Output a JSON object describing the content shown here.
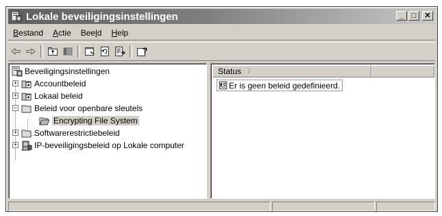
{
  "window": {
    "title": "Lokale beveiligingsinstellingen",
    "caption_buttons": [
      "_",
      "□",
      "✕"
    ]
  },
  "menu": [
    {
      "label": "Bestand",
      "accel_index": 0
    },
    {
      "label": "Actie",
      "accel_index": 0
    },
    {
      "label": "Beeld",
      "accel_index": 3
    },
    {
      "label": "Help",
      "accel_index": 0
    }
  ],
  "toolbar": {
    "buttons": [
      "back-icon",
      "forward-icon",
      "up-one-level-icon",
      "show-hide-tree-icon",
      "properties-icon",
      "refresh-icon",
      "export-list-icon",
      "help-icon"
    ]
  },
  "tree": {
    "root": "Beveiligingsinstellingen",
    "items": [
      {
        "label": "Accountbeleid",
        "expander": "+",
        "icon": "policy-folder-icon"
      },
      {
        "label": "Lokaal beleid",
        "expander": "+",
        "icon": "policy-folder-icon"
      },
      {
        "label": "Beleid voor openbare sleutels",
        "expander": "−",
        "icon": "folder-open-icon"
      },
      {
        "label": "Encrypting File System",
        "icon": "folder-icon",
        "selected": true
      },
      {
        "label": "Softwarerestrictiebeleid",
        "expander": "+",
        "icon": "folder-icon"
      },
      {
        "label": "IP-beveiligingsbeleid op Lokale computer",
        "expander": "+",
        "icon": "ip-security-icon"
      }
    ]
  },
  "list": {
    "column_status": "Status",
    "sort_indicator": "/",
    "rows": [
      {
        "text": "Er is geen beleid gedefinieerd.",
        "icon": "info-doc-icon"
      }
    ]
  },
  "colors": {
    "title_gradient_start": "#5f5f5f",
    "title_gradient_end": "#c8c8c8",
    "face": "#d4d0c8"
  }
}
